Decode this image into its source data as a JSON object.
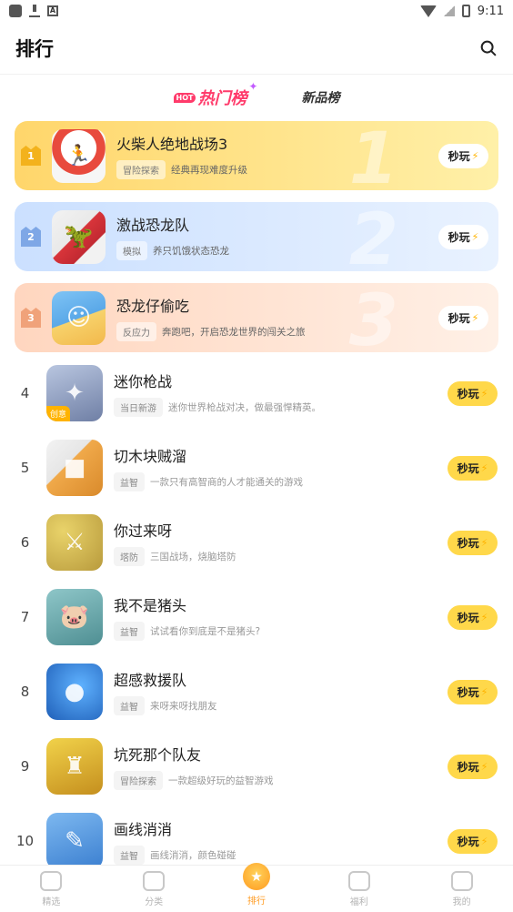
{
  "status_bar": {
    "time": "9:11"
  },
  "header": {
    "title": "排行"
  },
  "tabs": {
    "hot": "热门榜",
    "hot_badge": "HOT",
    "new": "新品榜"
  },
  "play_label": "秒玩",
  "top": [
    {
      "rank": "1",
      "name": "火柴人绝地战场3",
      "tag": "冒险探索",
      "desc": "经典再现难度升级"
    },
    {
      "rank": "2",
      "name": "激战恐龙队",
      "tag": "模拟",
      "desc": "养只饥饿状态恐龙"
    },
    {
      "rank": "3",
      "name": "恐龙仔偷吃",
      "tag": "反应力",
      "desc": "奔跑吧，开启恐龙世界的闯关之旅"
    }
  ],
  "list": [
    {
      "rank": "4",
      "name": "迷你枪战",
      "tag": "当日新游",
      "desc": "迷你世界枪战对决，做最强悍精英。",
      "badge": "创意",
      "color": "#7c8fb5"
    },
    {
      "rank": "5",
      "name": "切木块贼溜",
      "tag": "益智",
      "desc": "一款只有高智商的人才能通关的游戏",
      "color": "#e9a24a"
    },
    {
      "rank": "6",
      "name": "你过来呀",
      "tag": "塔防",
      "desc": "三国战场，烧脑塔防",
      "color": "#cbb24a"
    },
    {
      "rank": "7",
      "name": "我不是猪头",
      "tag": "益智",
      "desc": "试试看你到底是不是猪头?",
      "color": "#6aa3a8"
    },
    {
      "rank": "8",
      "name": "超感救援队",
      "tag": "益智",
      "desc": "来呀来呀找朋友",
      "color": "#3f7fd1"
    },
    {
      "rank": "9",
      "name": "坑死那个队友",
      "tag": "冒险探索",
      "desc": "一款超级好玩的益智游戏",
      "color": "#c9a533"
    },
    {
      "rank": "10",
      "name": "画线消消",
      "tag": "益智",
      "desc": "画线消消，颜色碰碰",
      "color": "#4a8fd6"
    }
  ],
  "nav": [
    {
      "label": "精选",
      "icon": "gamepad-icon"
    },
    {
      "label": "分类",
      "icon": "folder-icon"
    },
    {
      "label": "排行",
      "icon": "trophy-icon"
    },
    {
      "label": "福利",
      "icon": "gift-icon"
    },
    {
      "label": "我的",
      "icon": "profile-icon"
    }
  ]
}
